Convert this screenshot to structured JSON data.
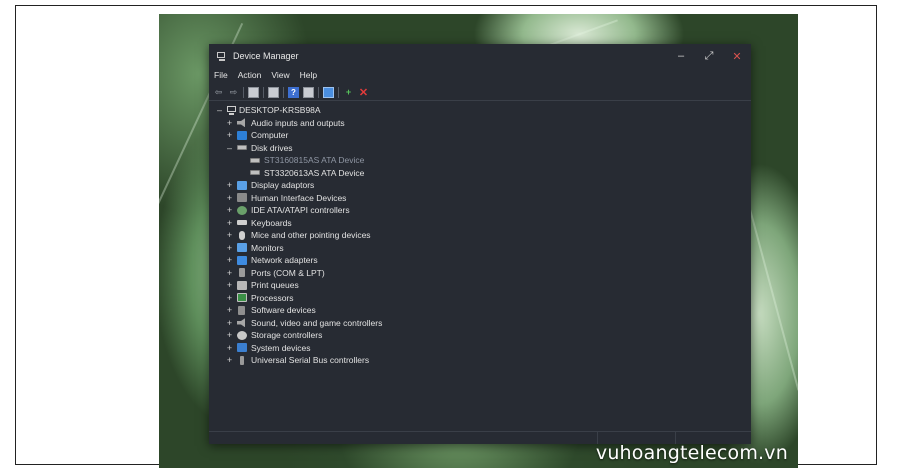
{
  "window": {
    "title": "Device Manager",
    "controls": {
      "minimize": "–",
      "maximize": "⤢",
      "close": "✕"
    }
  },
  "menu": [
    "File",
    "Action",
    "View",
    "Help"
  ],
  "toolbar": [
    "back-arrow-icon",
    "forward-arrow-icon",
    "properties-icon",
    "show-hidden-icon",
    "help-icon",
    "update-driver-icon",
    "scan-hardware-icon",
    "add-driver-icon",
    "uninstall-icon"
  ],
  "tree": {
    "root": "DESKTOP-KRSB98A",
    "items": [
      {
        "label": "Audio inputs and outputs",
        "icon": "audio-icon",
        "expander": "+"
      },
      {
        "label": "Computer",
        "icon": "computer-icon",
        "expander": "+"
      },
      {
        "label": "Disk drives",
        "icon": "disk-icon",
        "expander": "–",
        "children": [
          {
            "label": "ST3160815AS ATA Device",
            "icon": "disk-icon",
            "selected": true
          },
          {
            "label": "ST3320613AS ATA Device",
            "icon": "disk-icon"
          }
        ]
      },
      {
        "label": "Display adaptors",
        "icon": "display-icon",
        "expander": "+"
      },
      {
        "label": "Human Interface Devices",
        "icon": "hid-icon",
        "expander": "+"
      },
      {
        "label": "IDE ATA/ATAPI controllers",
        "icon": "ide-icon",
        "expander": "+"
      },
      {
        "label": "Keyboards",
        "icon": "keyboard-icon",
        "expander": "+"
      },
      {
        "label": "Mice and other pointing devices",
        "icon": "mouse-icon",
        "expander": "+"
      },
      {
        "label": "Monitors",
        "icon": "monitor-icon",
        "expander": "+"
      },
      {
        "label": "Network adapters",
        "icon": "network-icon",
        "expander": "+"
      },
      {
        "label": "Ports (COM & LPT)",
        "icon": "ports-icon",
        "expander": "+"
      },
      {
        "label": "Print queues",
        "icon": "printer-icon",
        "expander": "+"
      },
      {
        "label": "Processors",
        "icon": "processor-icon",
        "expander": "+"
      },
      {
        "label": "Software devices",
        "icon": "software-icon",
        "expander": "+"
      },
      {
        "label": "Sound, video and game controllers",
        "icon": "sound-icon",
        "expander": "+"
      },
      {
        "label": "Storage controllers",
        "icon": "storage-icon",
        "expander": "+"
      },
      {
        "label": "System devices",
        "icon": "system-icon",
        "expander": "+"
      },
      {
        "label": "Universal Serial Bus controllers",
        "icon": "usb-icon",
        "expander": "+"
      }
    ]
  },
  "watermark": "vuhoangtelecom.vn",
  "colors": {
    "window_bg": "#272b33",
    "text": "#e2e2e2",
    "selected_text": "#8f96a3",
    "close": "#d9534f"
  }
}
